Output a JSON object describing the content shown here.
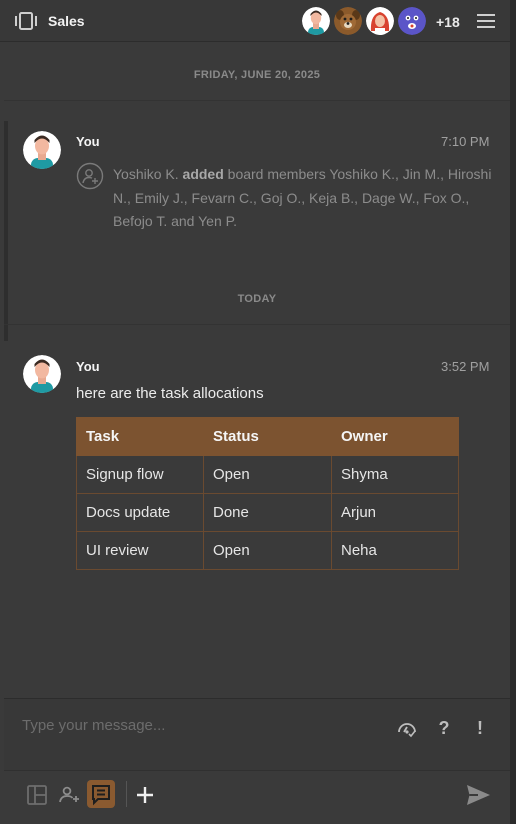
{
  "header": {
    "title": "Sales",
    "members_more": "+18",
    "avatars": [
      "avatar-man",
      "avatar-dog",
      "avatar-woman",
      "avatar-monster"
    ]
  },
  "separators": {
    "first": "FRIDAY, JUNE 20, 2025",
    "second": "TODAY"
  },
  "messages": [
    {
      "author": "You",
      "time": "7:10 PM",
      "system": {
        "actor": "Yoshiko K.",
        "action": "added",
        "rest": "board members Yoshiko K., Jin M., Hiroshi N., Emily J., Fevarn C., Goj O., Keja B., Dage W., Fox O., Befojo T. and Yen P."
      }
    },
    {
      "author": "You",
      "time": "3:52 PM",
      "text": "here are the task allocations",
      "table": {
        "headers": [
          "Task",
          "Status",
          "Owner"
        ],
        "rows": [
          [
            "Signup flow",
            "Open",
            "Shyma"
          ],
          [
            "Docs update",
            "Done",
            "Arjun"
          ],
          [
            "UI review",
            "Open",
            "Neha"
          ]
        ]
      }
    }
  ],
  "composer": {
    "placeholder": "Type your message...",
    "question_label": "?",
    "urgent_label": "!"
  },
  "colors": {
    "accent": "#8a5a30",
    "table_header": "#7c5330",
    "background": "#3a3a3a"
  }
}
